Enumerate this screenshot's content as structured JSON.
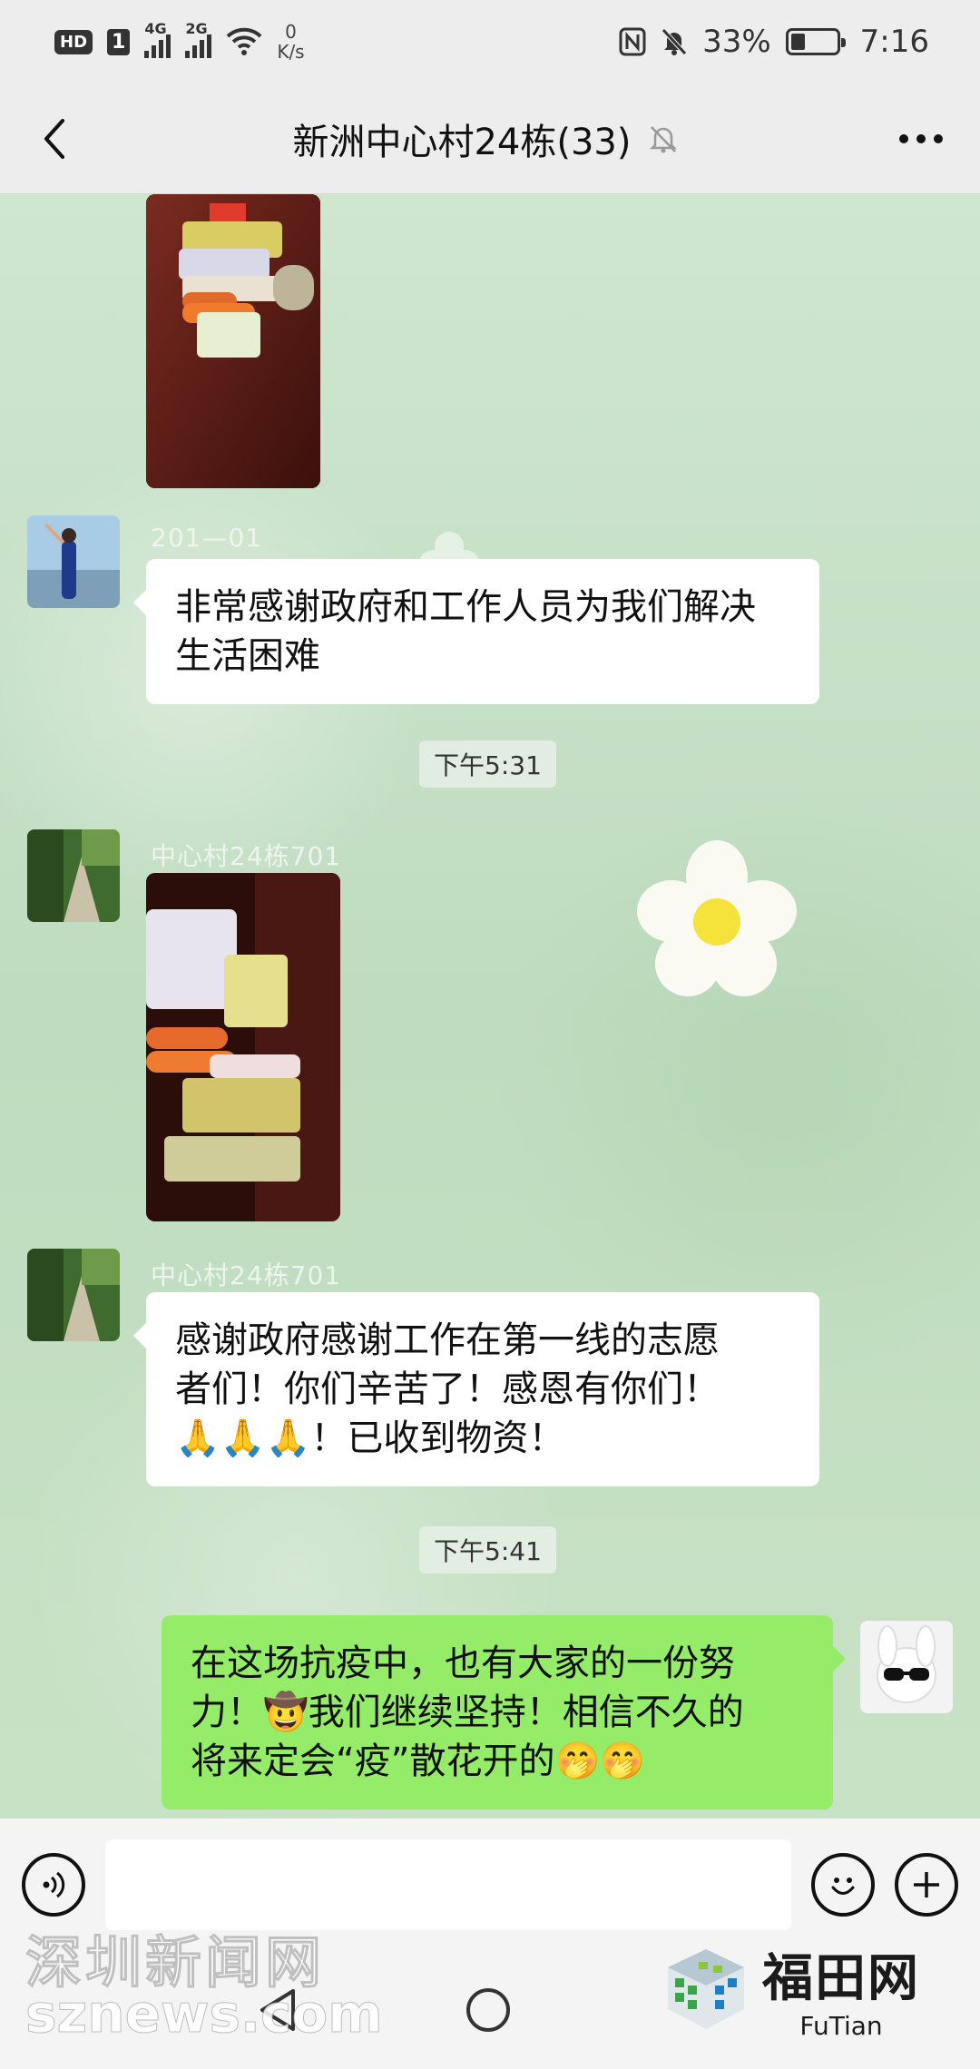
{
  "status_bar": {
    "hd_label": "HD",
    "sim1_label": "1",
    "sig1_tag": "4G",
    "sig2_tag": "2G",
    "net_speed_value": "0",
    "net_speed_unit": "K/s",
    "battery_percent": "33%",
    "battery_level": 0.33,
    "time": "7:16"
  },
  "header": {
    "title": "新洲中心村24栋(33)",
    "icons": [
      "back-chevron-icon",
      "mute-bell-icon",
      "more-dots-icon"
    ]
  },
  "messages": [
    {
      "type": "image",
      "side": "left",
      "content": "photo of packaged food and carrots"
    },
    {
      "type": "text",
      "side": "left",
      "sender": "201—01",
      "text": "非常感谢政府和工作人员为我们解决生活困难"
    },
    {
      "type": "time",
      "text": "下午5:31"
    },
    {
      "type": "image",
      "side": "left",
      "sender": "中心村24栋701",
      "content": "photo of groceries"
    },
    {
      "type": "text",
      "side": "left",
      "sender": "中心村24栋701",
      "text_lines": [
        "感谢政府感谢工作在第一线的志愿",
        "者们！你们辛苦了！感恩有你们！",
        "🙏🙏🙏！已收到物资！"
      ]
    },
    {
      "type": "time",
      "text": "下午5:41"
    },
    {
      "type": "text",
      "side": "right",
      "text_lines": [
        "在这场抗疫中，也有大家的一份努",
        "力！🤠我们继续坚持！相信不久的",
        "将来定会“疫”散花开的🤭🤭"
      ]
    }
  ],
  "input_bar": {
    "placeholder": "",
    "icons": [
      "voice-icon",
      "emoji-icon",
      "plus-icon"
    ]
  },
  "watermarks": {
    "left_line1": "深圳新闻网",
    "left_line2": "sznews.com",
    "right_cn": "福田网",
    "right_en": "FuTian"
  },
  "colors": {
    "mine_bubble": "#95ec69",
    "other_bubble": "#ffffff",
    "header_bg": "#ededed"
  }
}
